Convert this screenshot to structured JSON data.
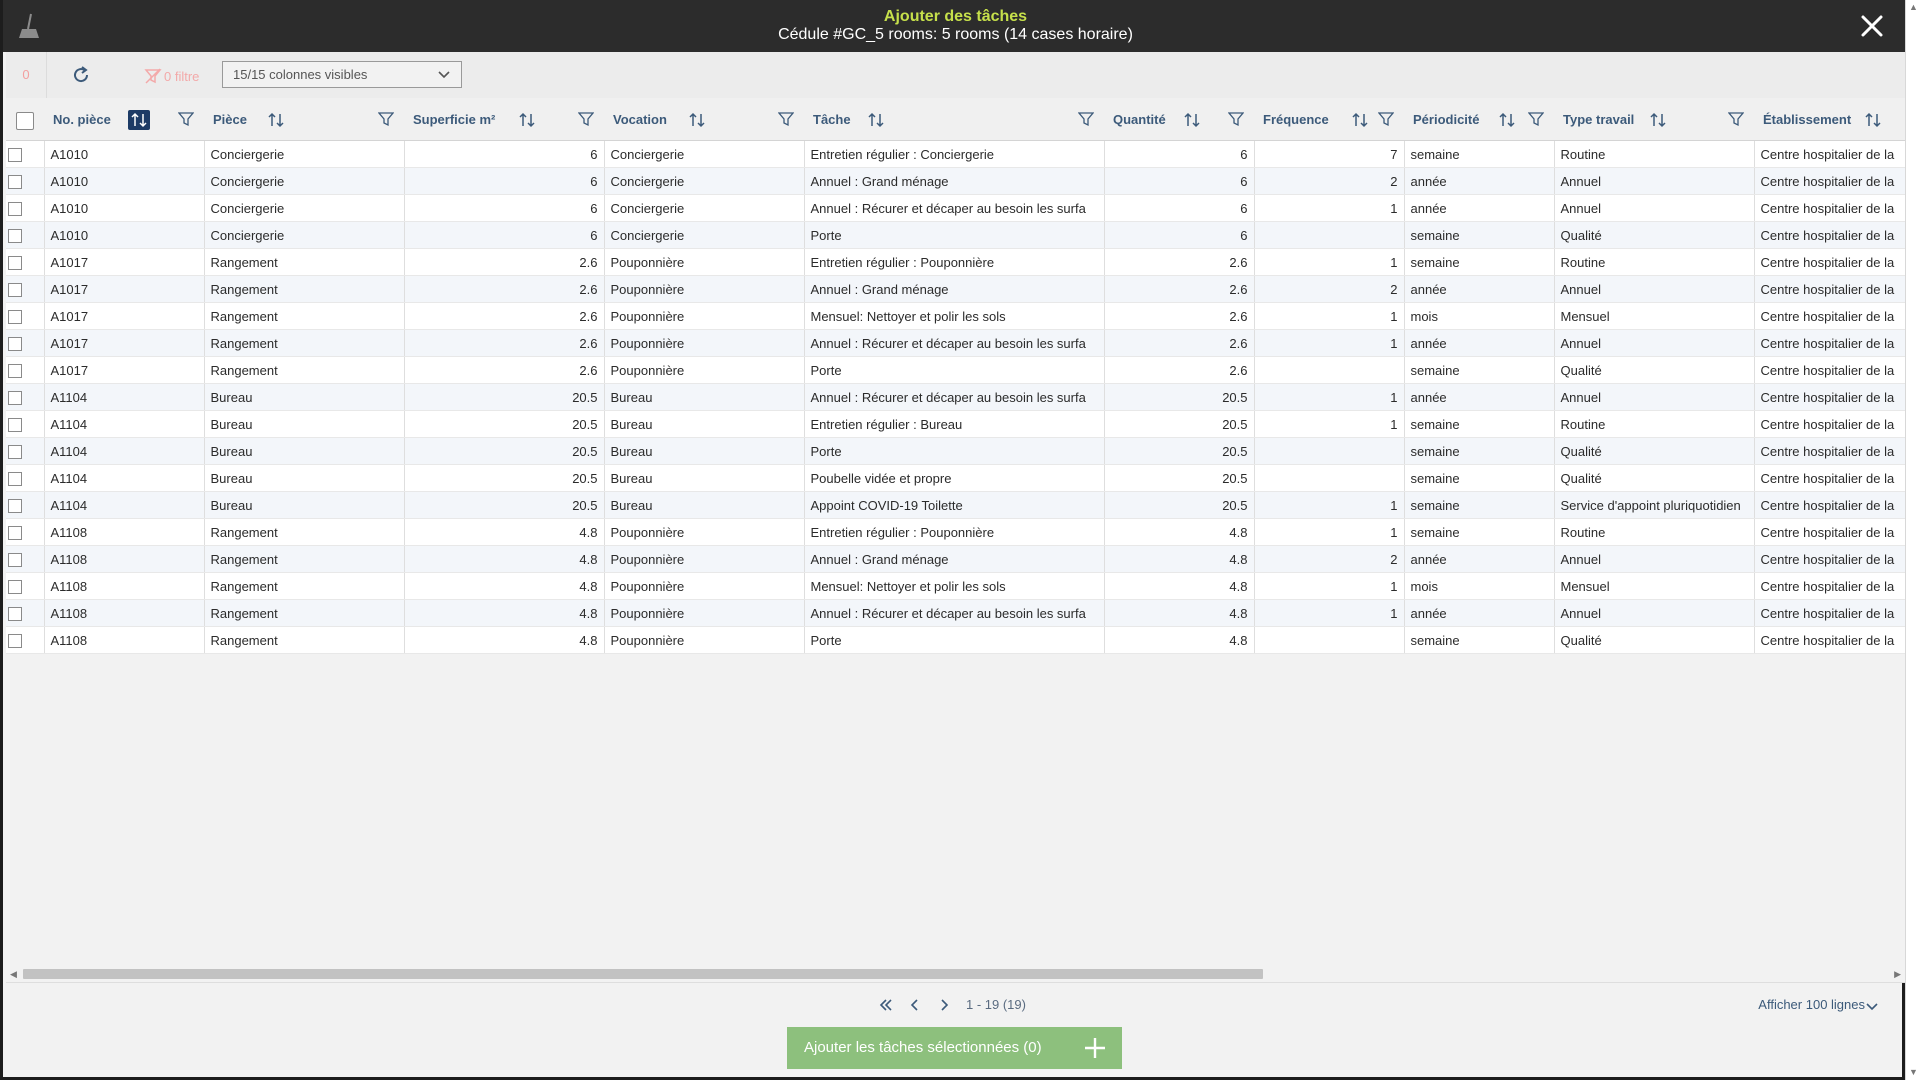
{
  "header": {
    "title": "Ajouter des tâches",
    "subtitle": "Cédule #GC_5 rooms: 5 rooms (14 cases horaire)"
  },
  "toolbar": {
    "selected_count": "0",
    "filter_label": "0 filtre",
    "columns_select": "15/15 colonnes visibles"
  },
  "table": {
    "columns": [
      "No. pièce",
      "Pièce",
      "Superficie m²",
      "Vocation",
      "Tâche",
      "Quantité",
      "Fréquence",
      "Périodicité",
      "Type travail",
      "Établissement"
    ],
    "rows": [
      [
        "A1010",
        "Conciergerie",
        "6",
        "Conciergerie",
        "Entretien régulier : Conciergerie",
        "6",
        "7",
        "semaine",
        "Routine",
        "Centre hospitalier de la"
      ],
      [
        "A1010",
        "Conciergerie",
        "6",
        "Conciergerie",
        "Annuel : Grand ménage",
        "6",
        "2",
        "année",
        "Annuel",
        "Centre hospitalier de la"
      ],
      [
        "A1010",
        "Conciergerie",
        "6",
        "Conciergerie",
        "Annuel : Récurer et décaper au besoin les surfa",
        "6",
        "1",
        "année",
        "Annuel",
        "Centre hospitalier de la"
      ],
      [
        "A1010",
        "Conciergerie",
        "6",
        "Conciergerie",
        "Porte",
        "6",
        "",
        "semaine",
        "Qualité",
        "Centre hospitalier de la"
      ],
      [
        "A1017",
        "Rangement",
        "2.6",
        "Pouponnière",
        "Entretien régulier : Pouponnière",
        "2.6",
        "1",
        "semaine",
        "Routine",
        "Centre hospitalier de la"
      ],
      [
        "A1017",
        "Rangement",
        "2.6",
        "Pouponnière",
        "Annuel : Grand ménage",
        "2.6",
        "2",
        "année",
        "Annuel",
        "Centre hospitalier de la"
      ],
      [
        "A1017",
        "Rangement",
        "2.6",
        "Pouponnière",
        "Mensuel: Nettoyer et polir les sols",
        "2.6",
        "1",
        "mois",
        "Mensuel",
        "Centre hospitalier de la"
      ],
      [
        "A1017",
        "Rangement",
        "2.6",
        "Pouponnière",
        "Annuel : Récurer et décaper au besoin les surfa",
        "2.6",
        "1",
        "année",
        "Annuel",
        "Centre hospitalier de la"
      ],
      [
        "A1017",
        "Rangement",
        "2.6",
        "Pouponnière",
        "Porte",
        "2.6",
        "",
        "semaine",
        "Qualité",
        "Centre hospitalier de la"
      ],
      [
        "A1104",
        "Bureau",
        "20.5",
        "Bureau",
        "Annuel : Récurer et décaper au besoin les surfa",
        "20.5",
        "1",
        "année",
        "Annuel",
        "Centre hospitalier de la"
      ],
      [
        "A1104",
        "Bureau",
        "20.5",
        "Bureau",
        "Entretien régulier : Bureau",
        "20.5",
        "1",
        "semaine",
        "Routine",
        "Centre hospitalier de la"
      ],
      [
        "A1104",
        "Bureau",
        "20.5",
        "Bureau",
        "Porte",
        "20.5",
        "",
        "semaine",
        "Qualité",
        "Centre hospitalier de la"
      ],
      [
        "A1104",
        "Bureau",
        "20.5",
        "Bureau",
        "Poubelle vidée et propre",
        "20.5",
        "",
        "semaine",
        "Qualité",
        "Centre hospitalier de la"
      ],
      [
        "A1104",
        "Bureau",
        "20.5",
        "Bureau",
        "Appoint COVID-19 Toilette",
        "20.5",
        "1",
        "semaine",
        "Service d'appoint pluriquotidien",
        "Centre hospitalier de la"
      ],
      [
        "A1108",
        "Rangement",
        "4.8",
        "Pouponnière",
        "Entretien régulier : Pouponnière",
        "4.8",
        "1",
        "semaine",
        "Routine",
        "Centre hospitalier de la"
      ],
      [
        "A1108",
        "Rangement",
        "4.8",
        "Pouponnière",
        "Annuel : Grand ménage",
        "4.8",
        "2",
        "année",
        "Annuel",
        "Centre hospitalier de la"
      ],
      [
        "A1108",
        "Rangement",
        "4.8",
        "Pouponnière",
        "Mensuel: Nettoyer et polir les sols",
        "4.8",
        "1",
        "mois",
        "Mensuel",
        "Centre hospitalier de la"
      ],
      [
        "A1108",
        "Rangement",
        "4.8",
        "Pouponnière",
        "Annuel : Récurer et décaper au besoin les surfa",
        "4.8",
        "1",
        "année",
        "Annuel",
        "Centre hospitalier de la"
      ],
      [
        "A1108",
        "Rangement",
        "4.8",
        "Pouponnière",
        "Porte",
        "4.8",
        "",
        "semaine",
        "Qualité",
        "Centre hospitalier de la"
      ]
    ]
  },
  "pager": {
    "info": "1 - 19 (19)",
    "rows_per_page": "Afficher 100 lignes"
  },
  "footer": {
    "add_button": "Ajouter les tâches sélectionnées (0)"
  },
  "colors": {
    "header_bg": "#2c2c2c",
    "title": "#c6e04b",
    "sort_active": "#1d3b66",
    "add_button": "#8dc07d"
  }
}
